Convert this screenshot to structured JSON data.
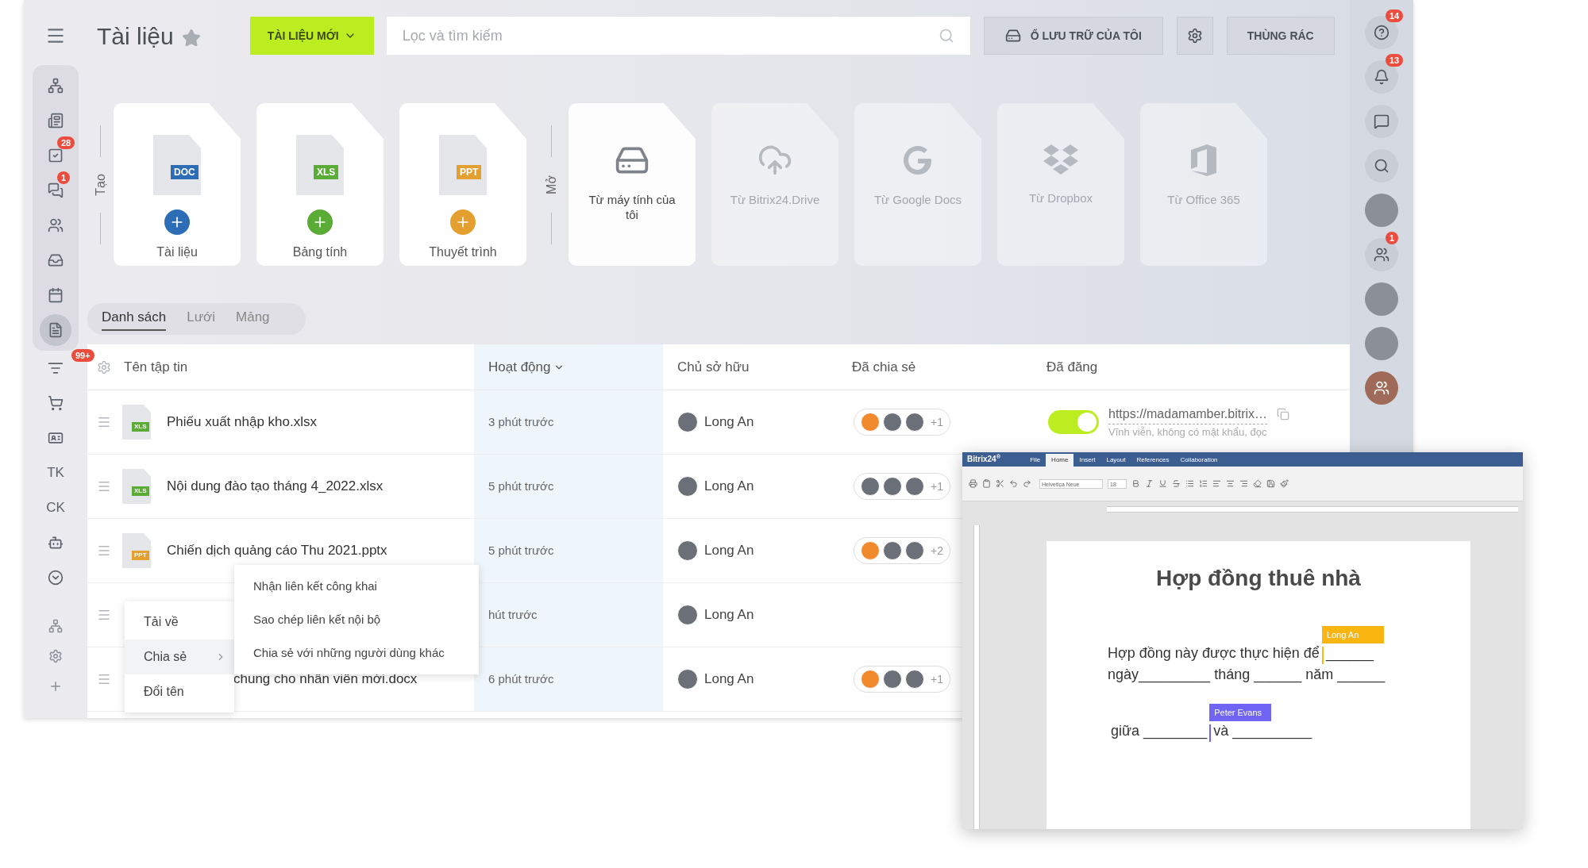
{
  "left_sidebar": {
    "items": [
      {
        "kind": "icon",
        "selected": false
      },
      {
        "kind": "icon",
        "selected": false
      },
      {
        "kind": "icon",
        "selected": false,
        "badge": "28"
      },
      {
        "kind": "icon",
        "selected": false,
        "badge": "1"
      },
      {
        "kind": "icon",
        "selected": false
      },
      {
        "kind": "icon",
        "selected": false
      },
      {
        "kind": "icon",
        "selected": false
      },
      {
        "kind": "icon",
        "selected": true
      },
      {
        "kind": "icon",
        "selected": false,
        "badge": "99+"
      },
      {
        "kind": "icon",
        "selected": false
      },
      {
        "kind": "icon",
        "selected": false
      },
      {
        "kind": "text",
        "label": "TK",
        "selected": false
      },
      {
        "kind": "text",
        "label": "CK",
        "selected": false
      },
      {
        "kind": "icon",
        "selected": false
      },
      {
        "kind": "icon",
        "selected": false
      }
    ],
    "bottom_items": [
      {
        "kind": "icon"
      },
      {
        "kind": "icon"
      },
      {
        "kind": "icon"
      }
    ]
  },
  "header": {
    "title": "Tài liệu",
    "new_button": "TÀI LIỆU MỚI",
    "search": {
      "placeholder": "Lọc và tìm kiếm"
    },
    "storage_button": "Ổ LƯU TRỮ CỦA TÔI",
    "trash_button": "THÙNG RÁC"
  },
  "create": {
    "label": "Tạo",
    "cards": [
      {
        "type": "DOC",
        "label": "Tài liệu"
      },
      {
        "type": "XLS",
        "label": "Bảng tính"
      },
      {
        "type": "PPT",
        "label": "Thuyết trình"
      }
    ]
  },
  "open": {
    "label": "Mở",
    "cards": [
      {
        "label": "Từ máy tính của tôi",
        "disabled": false
      },
      {
        "label": "Từ Bitrix24.Drive",
        "disabled": true
      },
      {
        "label": "Từ Google Docs",
        "disabled": true
      },
      {
        "label": "Từ Dropbox",
        "disabled": true
      },
      {
        "label": "Từ Office 365",
        "disabled": true
      }
    ]
  },
  "view_tabs": [
    {
      "label": "Danh sách",
      "selected": true
    },
    {
      "label": "Lưới",
      "selected": false
    },
    {
      "label": "Mảng",
      "selected": false
    }
  ],
  "table": {
    "columns": [
      {
        "label": "Tên tập tin",
        "sorted": false
      },
      {
        "label": "Hoạt động",
        "sorted": true
      },
      {
        "label": "Chủ sở hữu",
        "sorted": false
      },
      {
        "label": "Đã chia sẻ",
        "sorted": false
      },
      {
        "label": "Đã đăng",
        "sorted": false
      }
    ],
    "rows": [
      {
        "type": "XLS",
        "name": "Phiếu xuất nhập kho.xlsx",
        "activity": "3 phút trước",
        "owner": "Long An",
        "shared": {
          "avatars": [
            {
              "kind": "icon"
            },
            {
              "kind": "photo"
            },
            {
              "kind": "photo"
            }
          ],
          "more": "+1"
        },
        "published": {
          "on": true,
          "link": "https://madamamber.bitrix…",
          "note": "Vĩnh viễn, không có mật khẩu, đọc"
        }
      },
      {
        "type": "XLS",
        "name": "Nội dung đào tạo tháng 4_2022.xlsx",
        "activity": "5 phút trước",
        "owner": "Long An",
        "shared": {
          "avatars": [
            {
              "kind": "photo"
            },
            {
              "kind": "photo"
            },
            {
              "kind": "photo"
            }
          ],
          "more": "+1"
        }
      },
      {
        "type": "PPT",
        "name": "Chiến dịch quảng cáo Thu 2021.pptx",
        "activity": "5 phút trước",
        "owner": "Long An",
        "shared": {
          "avatars": [
            {
              "kind": "icon"
            },
            {
              "kind": "photo"
            },
            {
              "kind": "photo"
            }
          ],
          "more": "+2"
        }
      },
      {
        "activity": "hút trước",
        "owner": "Long An"
      },
      {
        "name": "chung cho nhân viên mới.docx",
        "activity": "6 phút trước",
        "owner": "Long An",
        "shared": {
          "avatars": [
            {
              "kind": "icon"
            },
            {
              "kind": "photo"
            },
            {
              "kind": "photo"
            }
          ],
          "more": "+1"
        }
      }
    ]
  },
  "context_menu": {
    "items": [
      {
        "label": "Tải về",
        "selected": false,
        "submenu": false
      },
      {
        "label": "Chia sẻ",
        "selected": true,
        "submenu": true
      },
      {
        "label": "Đổi tên",
        "selected": false,
        "submenu": false
      }
    ],
    "submenu": [
      "Nhận liên kết công khai",
      "Sao chép liên kết nội bộ",
      "Chia sẻ với những người dùng khác"
    ]
  },
  "right_sidebar": {
    "items": [
      {
        "kind": "icon",
        "badge": "14"
      },
      {
        "kind": "icon",
        "badge": "13"
      },
      {
        "kind": "icon"
      },
      {
        "kind": "icon"
      },
      {
        "kind": "avatar"
      },
      {
        "kind": "icon",
        "badge": "1"
      },
      {
        "kind": "avatar"
      },
      {
        "kind": "avatar"
      },
      {
        "kind": "icon"
      }
    ]
  },
  "editor": {
    "brand": "Bitrix24$^{®}$",
    "tabs": [
      {
        "label": "File",
        "selected": false
      },
      {
        "label": "Home",
        "selected": true
      },
      {
        "label": "Insert",
        "selected": false
      },
      {
        "label": "Layout",
        "selected": false
      },
      {
        "label": "References",
        "selected": false
      },
      {
        "label": "Collaboration",
        "selected": false
      }
    ],
    "font": "Helvetica Neue",
    "font_size": "18",
    "document": {
      "title": "Hợp đồng thuê nhà",
      "lines": [
        {
          "segments": [
            "Hợp đồng này được thực hiện để",
            "______"
          ]
        },
        {
          "segments": [
            "ngày_________  tháng ______ năm ______"
          ]
        },
        {
          "segments": [
            "giữa ________",
            "và __________"
          ]
        }
      ],
      "cursors": [
        {
          "name": "Long An",
          "color": "#fbb511"
        },
        {
          "name": "Peter Evans",
          "color": "#7064f4"
        }
      ]
    }
  }
}
